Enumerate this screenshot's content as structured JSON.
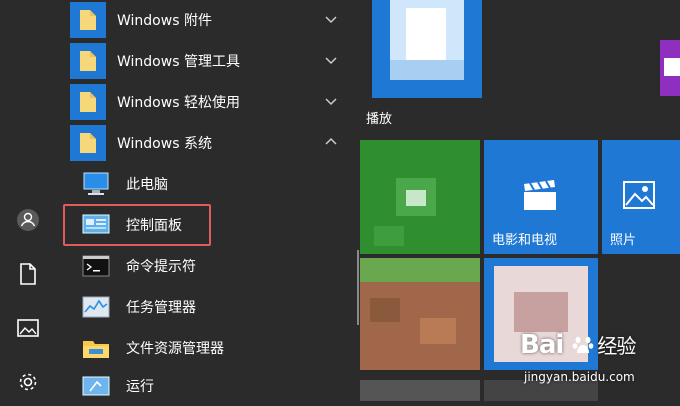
{
  "folders": [
    {
      "label": "Windows 附件",
      "icon": "folder-icon",
      "chevron": "chevron-down-icon"
    },
    {
      "label": "Windows 管理工具",
      "icon": "folder-icon",
      "chevron": "chevron-down-icon"
    },
    {
      "label": "Windows 轻松使用",
      "icon": "folder-icon",
      "chevron": "chevron-down-icon"
    },
    {
      "label": "Windows 系统",
      "icon": "folder-icon",
      "chevron": "chevron-up-icon"
    }
  ],
  "system_items": [
    {
      "label": "此电脑",
      "icon": "this-pc-icon"
    },
    {
      "label": "控制面板",
      "icon": "control-panel-icon"
    },
    {
      "label": "命令提示符",
      "icon": "command-prompt-icon"
    },
    {
      "label": "任务管理器",
      "icon": "task-manager-icon"
    },
    {
      "label": "文件资源管理器",
      "icon": "file-explorer-icon"
    },
    {
      "label": "运行",
      "icon": "run-icon"
    }
  ],
  "rail_icons": [
    "user-icon",
    "document-icon",
    "pictures-icon",
    "settings-icon"
  ],
  "tiles": {
    "group_label": "播放",
    "movies_label": "电影和电视",
    "photos_label": "照片"
  },
  "watermark": {
    "logo_text": "Bai",
    "logo_suffix": "经验",
    "url": "jingyan.baidu.com"
  },
  "colors": {
    "accent": "#1e78d4",
    "highlight_border": "#e05b5b",
    "green_tile": "#2f8f2f",
    "purple_tile": "#8e2fbf"
  }
}
